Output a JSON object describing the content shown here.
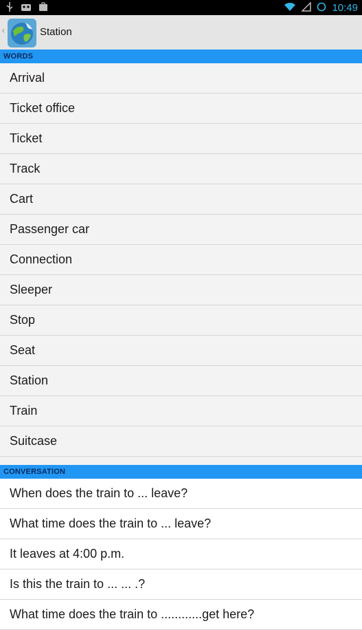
{
  "status_bar": {
    "time": "10:49",
    "left_icons": [
      "usb-icon",
      "android-debug-icon",
      "briefcase-icon"
    ],
    "right_icons": [
      "wifi-icon",
      "signal-icon",
      "alarm-icon"
    ]
  },
  "action_bar": {
    "title": "Station",
    "back": "‹"
  },
  "sections": {
    "words": {
      "header": "WORDS",
      "items": [
        "Arrival",
        "Ticket office",
        "Ticket",
        "Track",
        "Cart",
        "Passenger car",
        "Connection",
        "Sleeper",
        "Stop",
        "Seat",
        "Station",
        "Train",
        "Suitcase"
      ]
    },
    "conversation": {
      "header": "CONVERSATION",
      "items": [
        "When does the train to  ... leave?",
        "What time does the train to  ... leave?",
        "It leaves at 4:00 p.m.",
        "Is this the train to  ...  ... .?",
        "What time does the train to ............get here?"
      ]
    }
  },
  "colors": {
    "section_header": "#2196f3",
    "status_bar": "#000000",
    "time": "#33b5e5"
  }
}
